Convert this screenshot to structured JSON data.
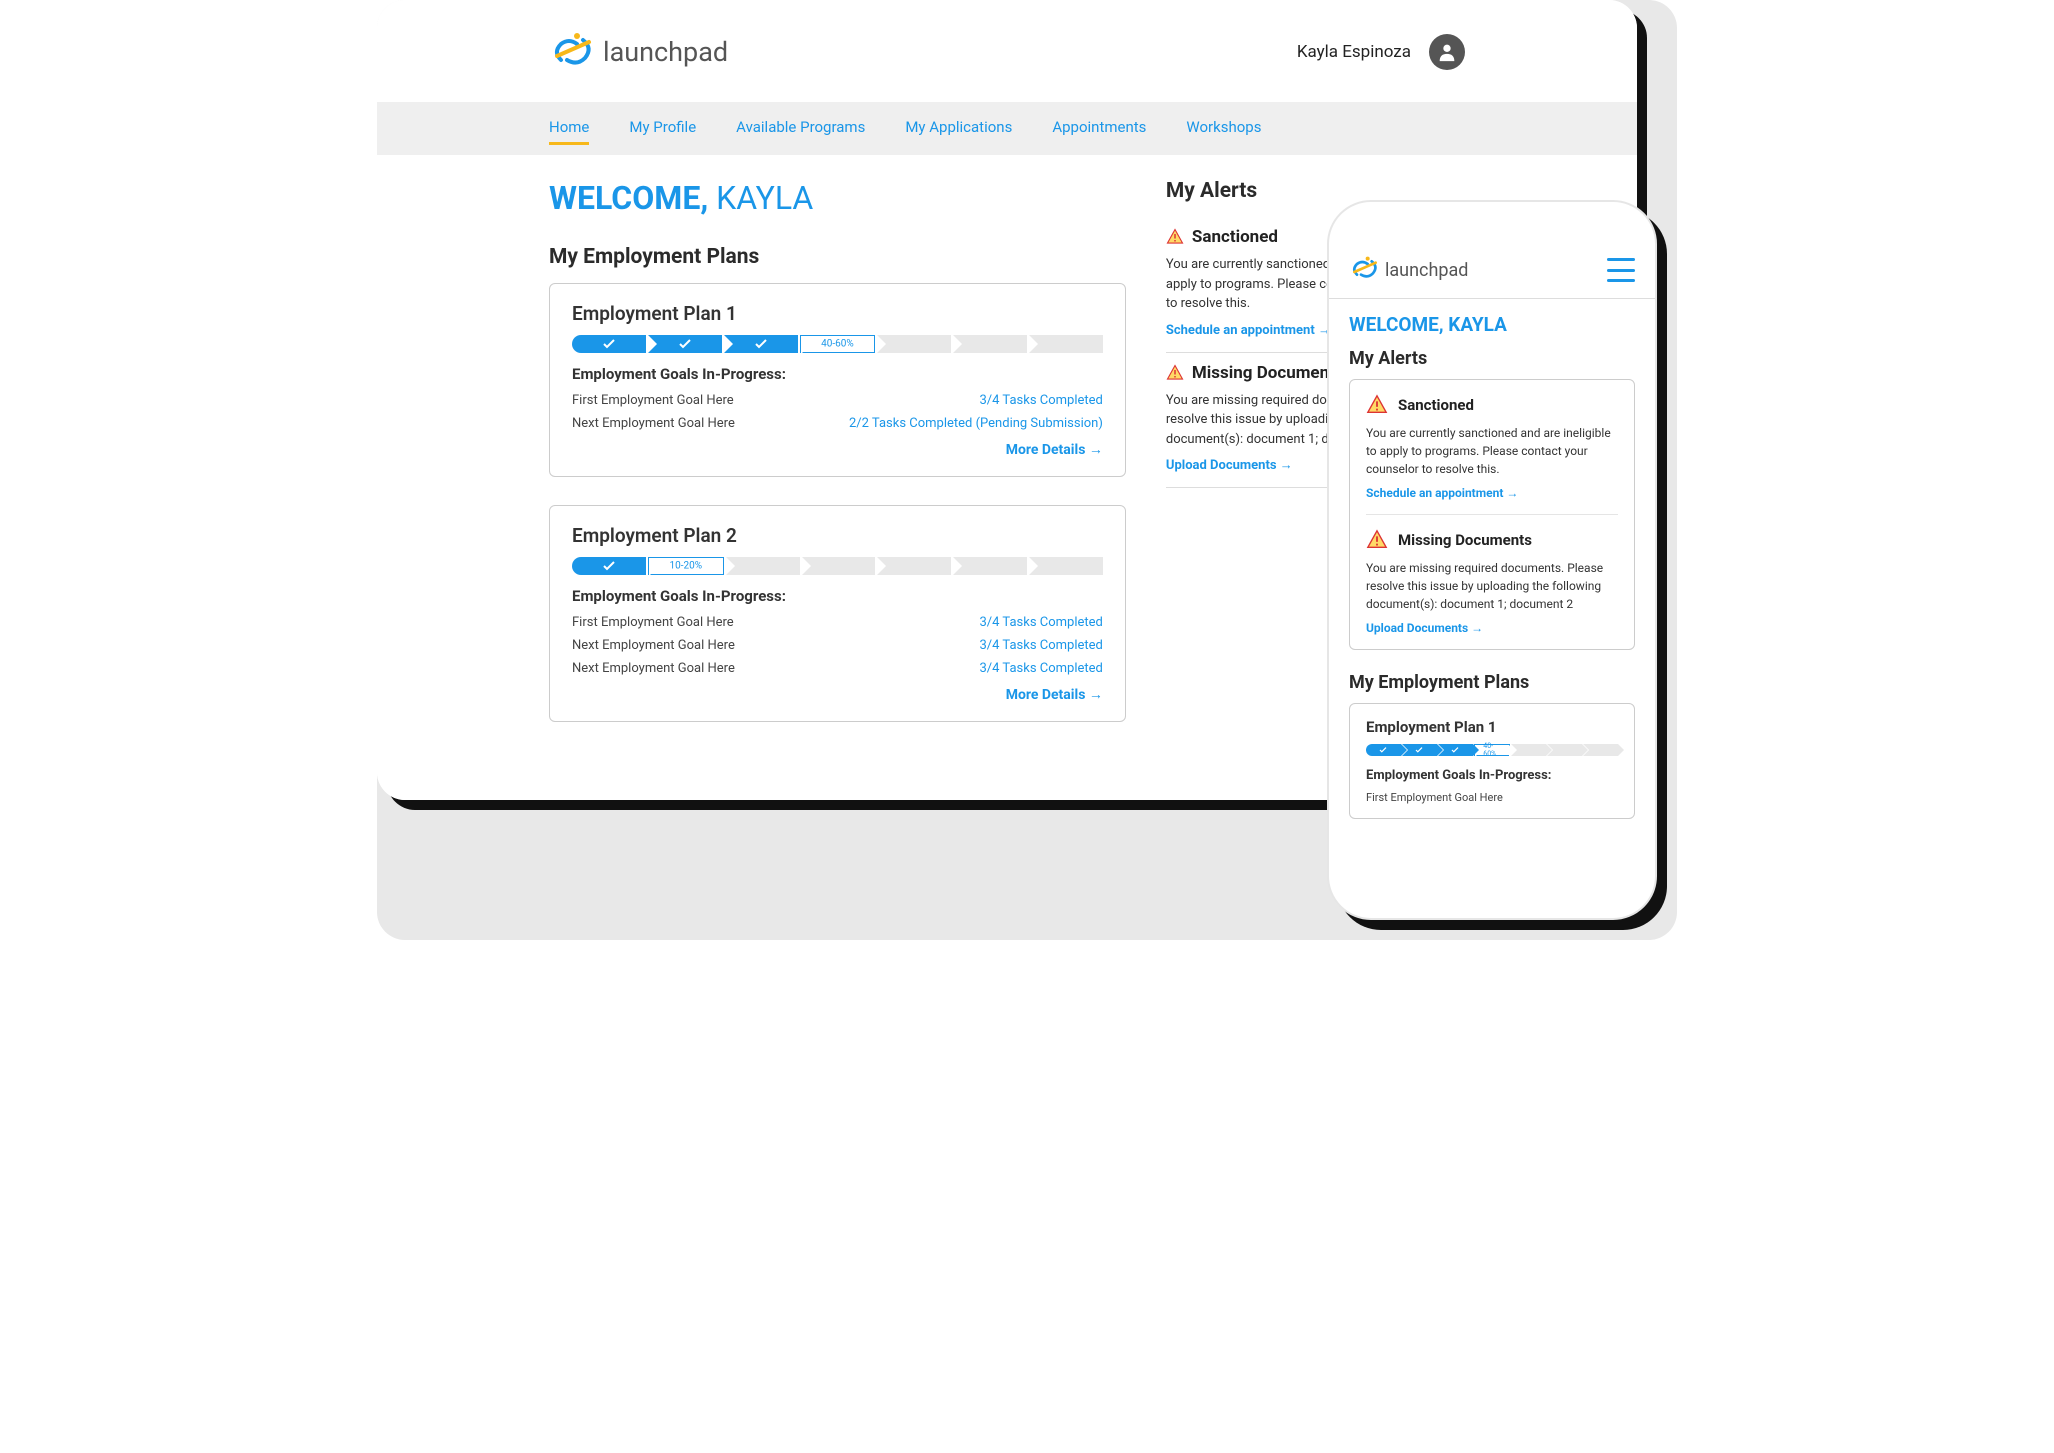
{
  "brand": "launchpad",
  "user_name": "Kayla Espinoza",
  "nav": {
    "items": [
      "Home",
      "My Profile",
      "Available Programs",
      "My Applications",
      "Appointments",
      "Workshops"
    ],
    "active": 0
  },
  "welcome": {
    "prefix": "WELCOME,",
    "name": "KAYLA"
  },
  "plans": {
    "title": "My Employment Plans",
    "goals_header": "Employment Goals In-Progress:",
    "more_details": "More Details →",
    "list": [
      {
        "title": "Employment Plan 1",
        "progress": [
          "done",
          "done",
          "done",
          "partial",
          "empty",
          "empty",
          "empty"
        ],
        "partial_label": "40-60%",
        "goals": [
          {
            "label": "First Employment Goal Here",
            "status": "3/4 Tasks Completed"
          },
          {
            "label": "Next Employment Goal Here",
            "status": "2/2 Tasks Completed (Pending Submission)"
          }
        ]
      },
      {
        "title": "Employment Plan 2",
        "progress": [
          "done",
          "partial",
          "empty",
          "empty",
          "empty",
          "empty",
          "empty"
        ],
        "partial_label": "10-20%",
        "goals": [
          {
            "label": "First Employment Goal Here",
            "status": "3/4 Tasks Completed"
          },
          {
            "label": "Next Employment Goal Here",
            "status": "3/4 Tasks Completed"
          },
          {
            "label": "Next Employment Goal Here",
            "status": "3/4 Tasks Completed"
          }
        ]
      }
    ]
  },
  "alerts": {
    "title": "My Alerts",
    "list": [
      {
        "title": "Sanctioned",
        "body": "You are currently sanctioned and are ineligible to apply to programs. Please contact your counselor to resolve this.",
        "link": "Schedule an appointment →"
      },
      {
        "title": "Missing Documents",
        "body": "You are missing required documents. Please resolve this issue by uploading the following document(s): document 1; document 2",
        "link": "Upload Documents →"
      }
    ]
  },
  "mobile": {
    "plan": {
      "title": "Employment Plan 1",
      "partial_label": "40-60%",
      "goals_header": "Employment Goals In-Progress:",
      "goal": "First Employment Goal Here"
    }
  }
}
